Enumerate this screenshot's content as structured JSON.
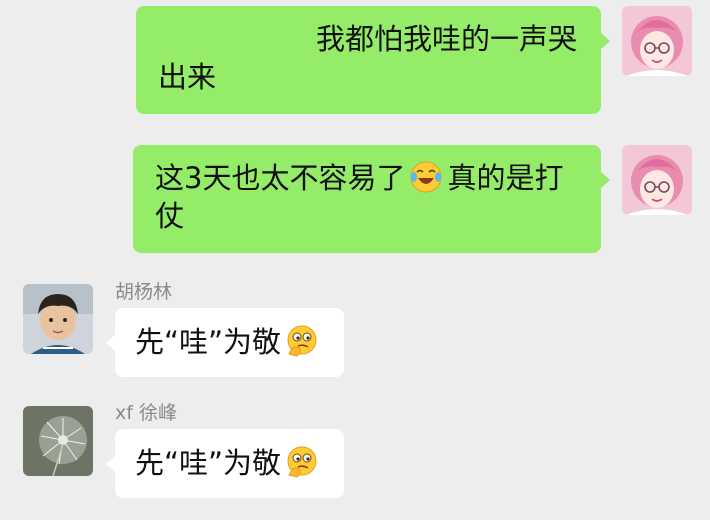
{
  "messages": [
    {
      "direction": "outgoing",
      "line1": "我都怕我哇的一声哭",
      "line2": "出来"
    },
    {
      "direction": "outgoing",
      "before_emoji": "这3天也太不容易了",
      "emoji": "laughing-crying-emoji",
      "after_emoji": "真的是打",
      "line2": "仗"
    },
    {
      "direction": "incoming",
      "sender": "胡杨林",
      "text": "先“哇”为敬",
      "emoji": "thinking-face-emoji"
    },
    {
      "direction": "incoming",
      "sender": "xf 徐峰",
      "text": "先“哇”为敬",
      "emoji": "thinking-face-emoji"
    }
  ],
  "colors": {
    "background": "#ededed",
    "outgoing_bubble": "#95ec69",
    "incoming_bubble": "#ffffff",
    "sender_name": "#8a8a8a"
  }
}
